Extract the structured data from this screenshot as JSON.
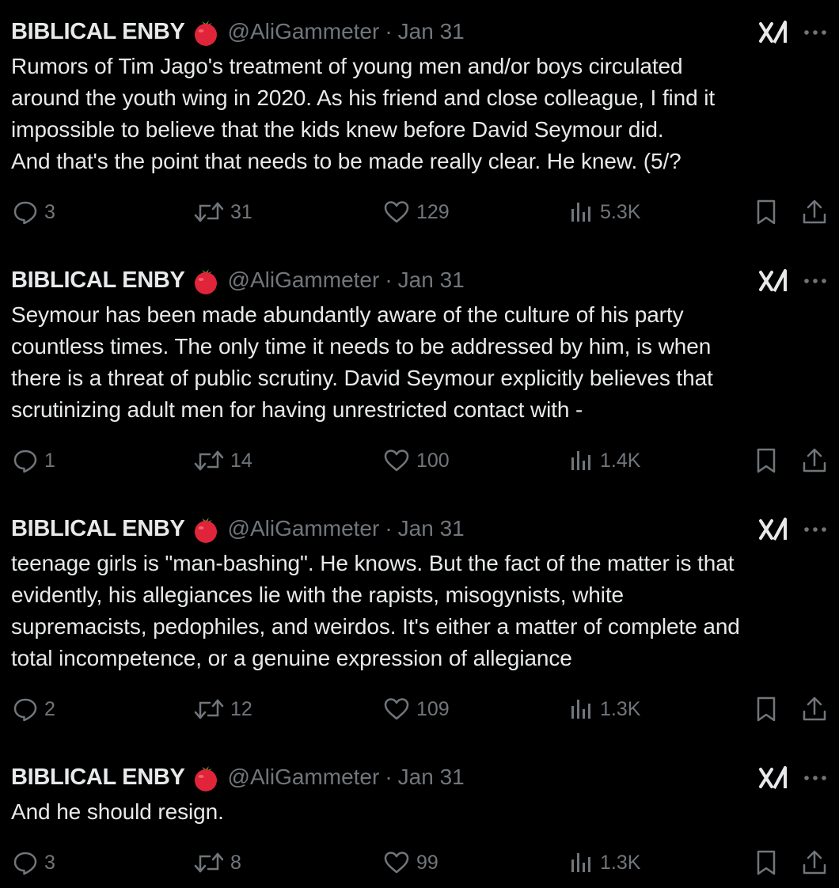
{
  "author": {
    "name": "BIBLICAL ENBY",
    "handle": "@AliGammeter",
    "badge_icon": "tomato-emoji"
  },
  "separator": "·",
  "colors": {
    "background": "#000000",
    "text": "#e7e9ea",
    "secondary": "#71767b",
    "tomato": "#e0243a"
  },
  "tweets": [
    {
      "date": "Jan 31",
      "text": "Rumors of Tim Jago's treatment of young men and/or boys circulated\naround the youth wing in 2020. As his friend and close colleague, I find it\nimpossible to believe that the kids knew before David Seymour did.\nAnd that's the point that needs to be made really clear. He knew. (5/?",
      "replies": "3",
      "reposts": "31",
      "likes": "129",
      "views": "5.3K"
    },
    {
      "date": "Jan 31",
      "text": "Seymour has been made abundantly aware of the culture of his party\ncountless times. The only time it needs to be addressed by him, is when\nthere is a threat of public scrutiny. David Seymour explicitly believes that\nscrutinizing adult men for having unrestricted contact with -",
      "replies": "1",
      "reposts": "14",
      "likes": "100",
      "views": "1.4K"
    },
    {
      "date": "Jan 31",
      "text": "teenage girls is \"man-bashing\". He knows. But the fact of the matter is that\nevidently, his allegiances lie with the rapists, misogynists, white\nsupremacists, pedophiles, and weirdos. It's either a matter of complete and\ntotal incompetence, or a genuine expression of allegiance",
      "replies": "2",
      "reposts": "12",
      "likes": "109",
      "views": "1.3K"
    },
    {
      "date": "Jan 31",
      "text": "And he should resign.",
      "replies": "3",
      "reposts": "8",
      "likes": "99",
      "views": "1.3K"
    }
  ]
}
